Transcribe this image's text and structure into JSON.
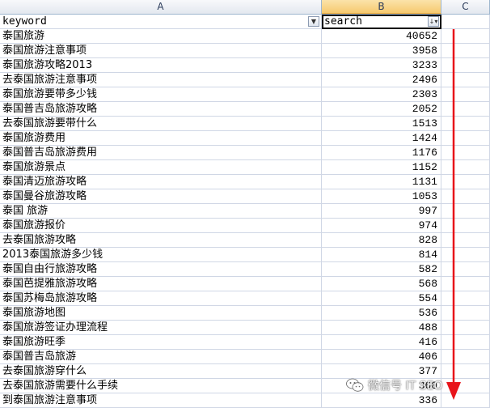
{
  "columns": [
    "A",
    "B",
    "C"
  ],
  "header": {
    "keyword": "keyword",
    "search": "search"
  },
  "rows": [
    {
      "keyword": "泰国旅游",
      "search": "40652"
    },
    {
      "keyword": "泰国旅游注意事项",
      "search": "3958"
    },
    {
      "keyword": "泰国旅游攻略2013",
      "search": "3233"
    },
    {
      "keyword": "去泰国旅游注意事项",
      "search": "2496"
    },
    {
      "keyword": "泰国旅游要带多少钱",
      "search": "2303"
    },
    {
      "keyword": "泰国普吉岛旅游攻略",
      "search": "2052"
    },
    {
      "keyword": "去泰国旅游要带什么",
      "search": "1513"
    },
    {
      "keyword": "泰国旅游费用",
      "search": "1424"
    },
    {
      "keyword": "泰国普吉岛旅游费用",
      "search": "1176"
    },
    {
      "keyword": "泰国旅游景点",
      "search": "1152"
    },
    {
      "keyword": "泰国清迈旅游攻略",
      "search": "1131"
    },
    {
      "keyword": "泰国曼谷旅游攻略",
      "search": "1053"
    },
    {
      "keyword": "泰国 旅游",
      "search": "997"
    },
    {
      "keyword": "泰国旅游报价",
      "search": "974"
    },
    {
      "keyword": "去泰国旅游攻略",
      "search": "828"
    },
    {
      "keyword": "2013泰国旅游多少钱",
      "search": "814"
    },
    {
      "keyword": "泰国自由行旅游攻略",
      "search": "582"
    },
    {
      "keyword": "泰国芭提雅旅游攻略",
      "search": "568"
    },
    {
      "keyword": "泰国苏梅岛旅游攻略",
      "search": "554"
    },
    {
      "keyword": "泰国旅游地图",
      "search": "536"
    },
    {
      "keyword": "泰国旅游签证办理流程",
      "search": "488"
    },
    {
      "keyword": "泰国旅游旺季",
      "search": "416"
    },
    {
      "keyword": "泰国普吉岛旅游",
      "search": "406"
    },
    {
      "keyword": "去泰国旅游穿什么",
      "search": "377"
    },
    {
      "keyword": "去泰国旅游需要什么手续",
      "search": "360"
    },
    {
      "keyword": "到泰国旅游注意事项",
      "search": "336"
    }
  ],
  "watermark": "微信号 IT SEO",
  "icons": {
    "filter_a": "dropdown-arrow-icon",
    "filter_b": "sort-descending-icon",
    "watermark": "wechat-icon",
    "arrow": "down-arrow-icon"
  },
  "colors": {
    "gridline": "#d0d7e5",
    "selected_header": "#f6c96f",
    "arrow": "#e8141a"
  }
}
